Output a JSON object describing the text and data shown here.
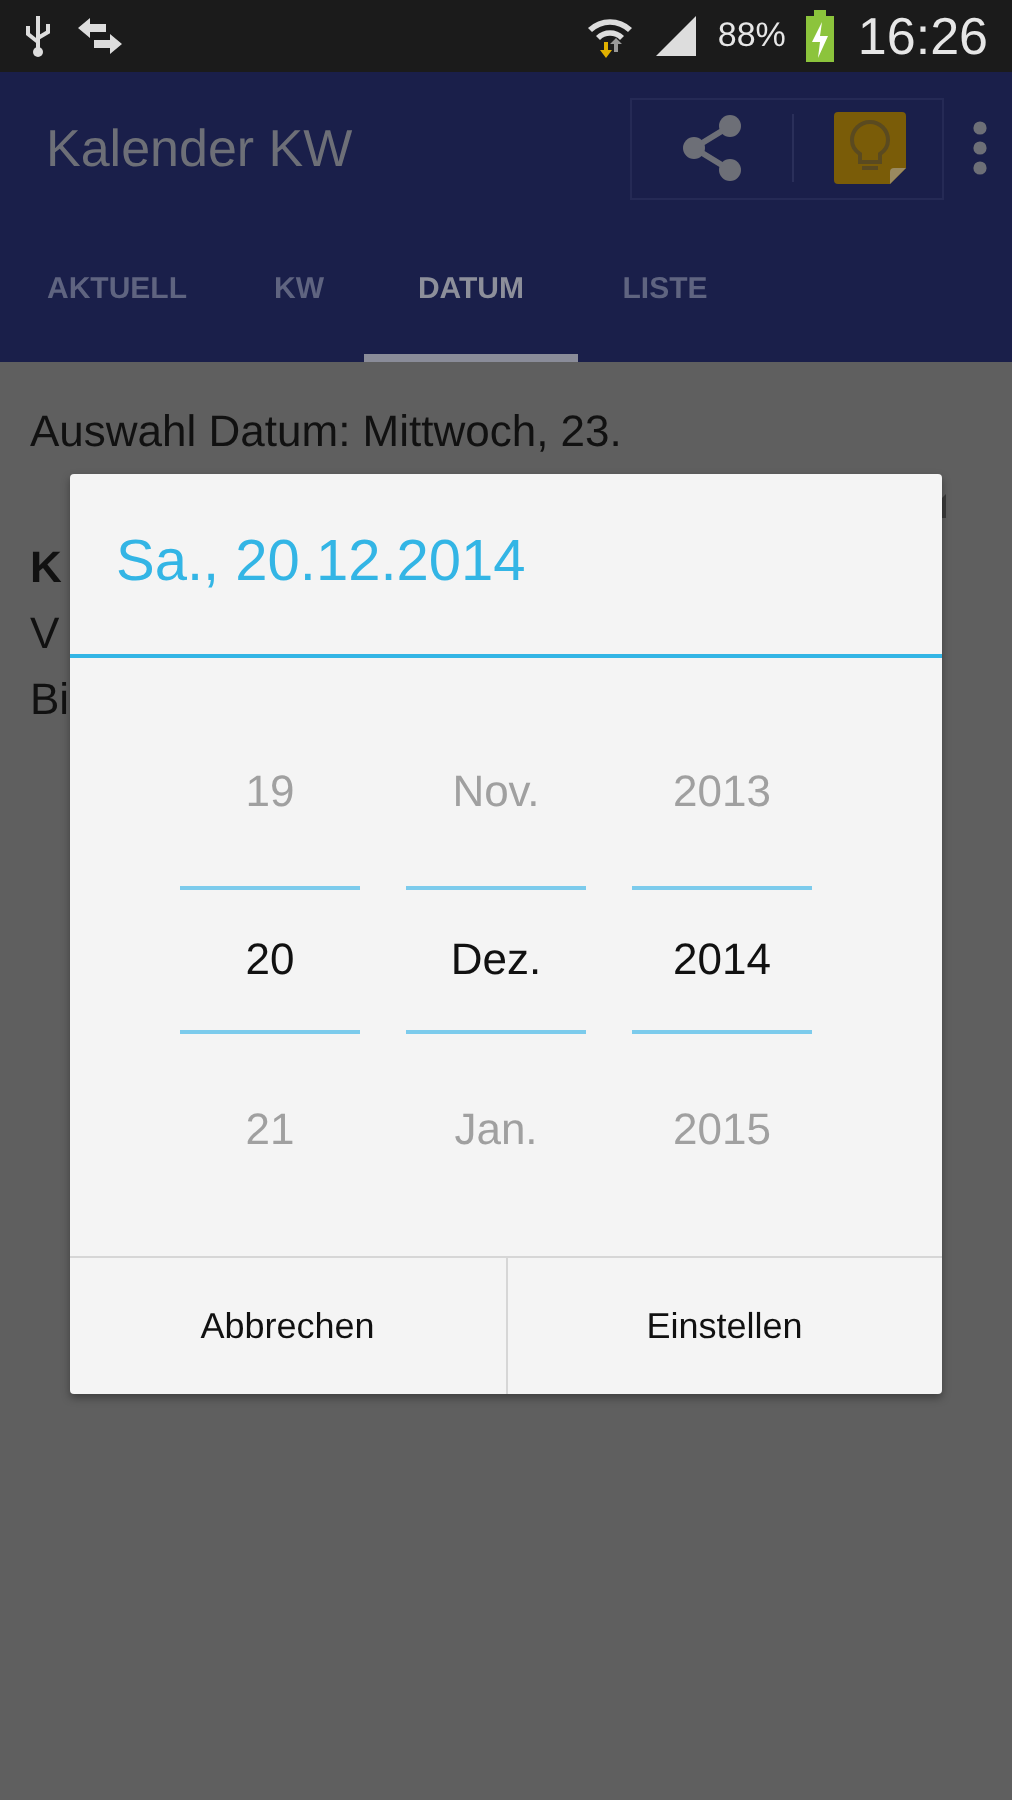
{
  "status_bar": {
    "battery": "88%",
    "time": "16:26"
  },
  "action_bar": {
    "title": "Kalender KW"
  },
  "tabs": [
    {
      "label": "AKTUELL",
      "selected": false
    },
    {
      "label": "KW",
      "selected": false
    },
    {
      "label": "DATUM",
      "selected": true
    },
    {
      "label": "LISTE",
      "selected": false
    }
  ],
  "content": {
    "selection_label": "Auswahl Datum: Mittwoch, 23.",
    "lines": [
      {
        "text": "K",
        "bold": true
      },
      {
        "text": "V",
        "bold": false
      },
      {
        "text": "Bi",
        "bold": false
      }
    ]
  },
  "dialog": {
    "title": "Sa., 20.12.2014",
    "pickers": [
      {
        "items": [
          {
            "label": "19",
            "selected": false
          },
          {
            "label": "20",
            "selected": true
          },
          {
            "label": "21",
            "selected": false
          }
        ]
      },
      {
        "items": [
          {
            "label": "Nov.",
            "selected": false
          },
          {
            "label": "Dez.",
            "selected": true
          },
          {
            "label": "Jan.",
            "selected": false
          }
        ]
      },
      {
        "items": [
          {
            "label": "2013",
            "selected": false
          },
          {
            "label": "2014",
            "selected": true
          },
          {
            "label": "2015",
            "selected": false
          }
        ]
      }
    ],
    "buttons": [
      "Abbrechen",
      "Einstellen"
    ]
  }
}
